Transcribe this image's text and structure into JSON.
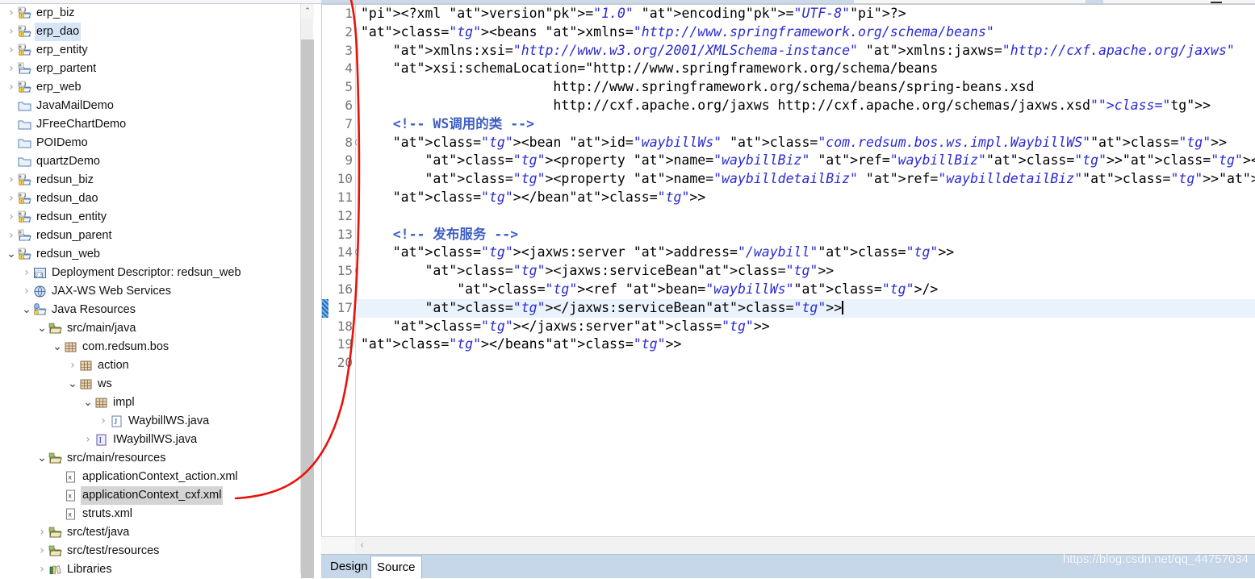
{
  "window": {
    "watermark": "https://blog.csdn.net/qq_44757034"
  },
  "toolbar": {
    "chunks": 3
  },
  "explorer": {
    "name": "Project Explorer",
    "scrollbar": {
      "up_arrow": "⌃"
    },
    "items": [
      {
        "indent": 0,
        "twisty": "collapsed",
        "icon": "maven-java-project-icon",
        "label": "erp_biz",
        "state": "normal"
      },
      {
        "indent": 0,
        "twisty": "collapsed",
        "icon": "maven-java-project-icon",
        "label": "erp_dao",
        "state": "selected"
      },
      {
        "indent": 0,
        "twisty": "collapsed",
        "icon": "maven-java-project-icon",
        "label": "erp_entity",
        "state": "normal"
      },
      {
        "indent": 0,
        "twisty": "collapsed",
        "icon": "maven-project-icon",
        "label": "erp_partent",
        "state": "normal"
      },
      {
        "indent": 0,
        "twisty": "collapsed",
        "icon": "maven-java-project-icon",
        "label": "erp_web",
        "state": "normal"
      },
      {
        "indent": 0,
        "twisty": "none",
        "icon": "folder-icon",
        "label": "JavaMailDemo",
        "state": "normal"
      },
      {
        "indent": 0,
        "twisty": "none",
        "icon": "folder-icon",
        "label": "JFreeChartDemo",
        "state": "normal"
      },
      {
        "indent": 0,
        "twisty": "none",
        "icon": "folder-icon",
        "label": "POIDemo",
        "state": "normal"
      },
      {
        "indent": 0,
        "twisty": "none",
        "icon": "folder-icon",
        "label": "quartzDemo",
        "state": "normal"
      },
      {
        "indent": 0,
        "twisty": "collapsed",
        "icon": "maven-java-project-icon",
        "label": "redsun_biz",
        "state": "normal"
      },
      {
        "indent": 0,
        "twisty": "collapsed",
        "icon": "maven-java-project-icon",
        "label": "redsun_dao",
        "state": "normal"
      },
      {
        "indent": 0,
        "twisty": "collapsed",
        "icon": "maven-java-project-icon",
        "label": "redsun_entity",
        "state": "normal"
      },
      {
        "indent": 0,
        "twisty": "collapsed",
        "icon": "maven-project-icon",
        "label": "redsun_parent",
        "state": "normal"
      },
      {
        "indent": 0,
        "twisty": "expanded",
        "icon": "maven-java-project-icon",
        "label": "redsun_web",
        "state": "normal"
      },
      {
        "indent": 1,
        "twisty": "collapsed",
        "icon": "deployment-descriptor-icon",
        "label": "Deployment Descriptor: redsun_web",
        "state": "normal"
      },
      {
        "indent": 1,
        "twisty": "collapsed",
        "icon": "jaxws-web-services-icon",
        "label": "JAX-WS Web Services",
        "state": "normal"
      },
      {
        "indent": 1,
        "twisty": "expanded",
        "icon": "java-resources-icon",
        "label": "Java Resources",
        "state": "normal"
      },
      {
        "indent": 2,
        "twisty": "expanded",
        "icon": "source-folder-icon",
        "label": "src/main/java",
        "state": "normal"
      },
      {
        "indent": 3,
        "twisty": "expanded",
        "icon": "package-icon",
        "label": "com.redsum.bos",
        "state": "normal"
      },
      {
        "indent": 4,
        "twisty": "collapsed",
        "icon": "package-icon",
        "label": "action",
        "state": "normal"
      },
      {
        "indent": 4,
        "twisty": "expanded",
        "icon": "package-icon",
        "label": "ws",
        "state": "normal"
      },
      {
        "indent": 5,
        "twisty": "expanded",
        "icon": "package-icon",
        "label": "impl",
        "state": "normal"
      },
      {
        "indent": 6,
        "twisty": "collapsed",
        "icon": "java-class-icon",
        "label": "WaybillWS.java",
        "state": "normal"
      },
      {
        "indent": 5,
        "twisty": "collapsed",
        "icon": "java-interface-icon",
        "label": "IWaybillWS.java",
        "state": "normal"
      },
      {
        "indent": 2,
        "twisty": "expanded",
        "icon": "source-folder-icon",
        "label": "src/main/resources",
        "state": "normal"
      },
      {
        "indent": 3,
        "twisty": "none",
        "icon": "xml-file-icon",
        "label": "applicationContext_action.xml",
        "state": "normal"
      },
      {
        "indent": 3,
        "twisty": "none",
        "icon": "xml-file-icon",
        "label": "applicationContext_cxf.xml",
        "state": "grayselected"
      },
      {
        "indent": 3,
        "twisty": "none",
        "icon": "xml-file-icon",
        "label": "struts.xml",
        "state": "normal"
      },
      {
        "indent": 2,
        "twisty": "collapsed",
        "icon": "source-folder-icon",
        "label": "src/test/java",
        "state": "normal"
      },
      {
        "indent": 2,
        "twisty": "collapsed",
        "icon": "source-folder-icon",
        "label": "src/test/resources",
        "state": "normal"
      },
      {
        "indent": 2,
        "twisty": "collapsed",
        "icon": "libraries-icon",
        "label": "Libraries",
        "state": "normal"
      }
    ]
  },
  "editor": {
    "current_line": 17,
    "change_bar_line": 17,
    "fold_lines": [
      2,
      8,
      14,
      15
    ],
    "line_count": 20,
    "line_numbers": [
      "1",
      "2",
      "3",
      "4",
      "5",
      "6",
      "7",
      "8",
      "9",
      "10",
      "11",
      "12",
      "13",
      "14",
      "15",
      "16",
      "17",
      "18",
      "19",
      "20"
    ],
    "lines": [
      "<?xml version=\"1.0\" encoding=\"UTF-8\"?>",
      "<beans xmlns=\"http://www.springframework.org/schema/beans\"",
      "    xmlns:xsi=\"http://www.w3.org/2001/XMLSchema-instance\" xmlns:jaxws=\"http://cxf.apache.org/jaxws\"",
      "    xsi:schemaLocation=\"http://www.springframework.org/schema/beans",
      "                        http://www.springframework.org/schema/beans/spring-beans.xsd",
      "                        http://cxf.apache.org/jaxws http://cxf.apache.org/schemas/jaxws.xsd\">",
      "    <!-- WS调用的类 -->",
      "    <bean id=\"waybillWs\" class=\"com.redsum.bos.ws.impl.WaybillWS\">",
      "        <property name=\"waybillBiz\" ref=\"waybillBiz\"></property>",
      "        <property name=\"waybilldetailBiz\" ref=\"waybilldetailBiz\"></property>",
      "    </bean>",
      "",
      "    <!-- 发布服务 -->",
      "    <jaxws:server address=\"/waybill\">",
      "        <jaxws:serviceBean>",
      "            <ref bean=\"waybillWs\"/>",
      "        </jaxws:serviceBean>",
      "    </jaxws:server>",
      "</beans>",
      ""
    ],
    "scroll_left_arrow": "‹",
    "tabs": [
      {
        "label": "Design",
        "active": false
      },
      {
        "label": "Source",
        "active": true
      }
    ]
  },
  "colors": {
    "tag": "#276b77",
    "attribute": "#8b1a5b",
    "value": "#2a2ad6",
    "comment": "#3f5fc4",
    "current_line_bg": "#eaf2fb",
    "selection_bg": "#d6e6f7",
    "annotation_red": "#e8120b",
    "tabbar_bg": "#c6d7ea"
  }
}
